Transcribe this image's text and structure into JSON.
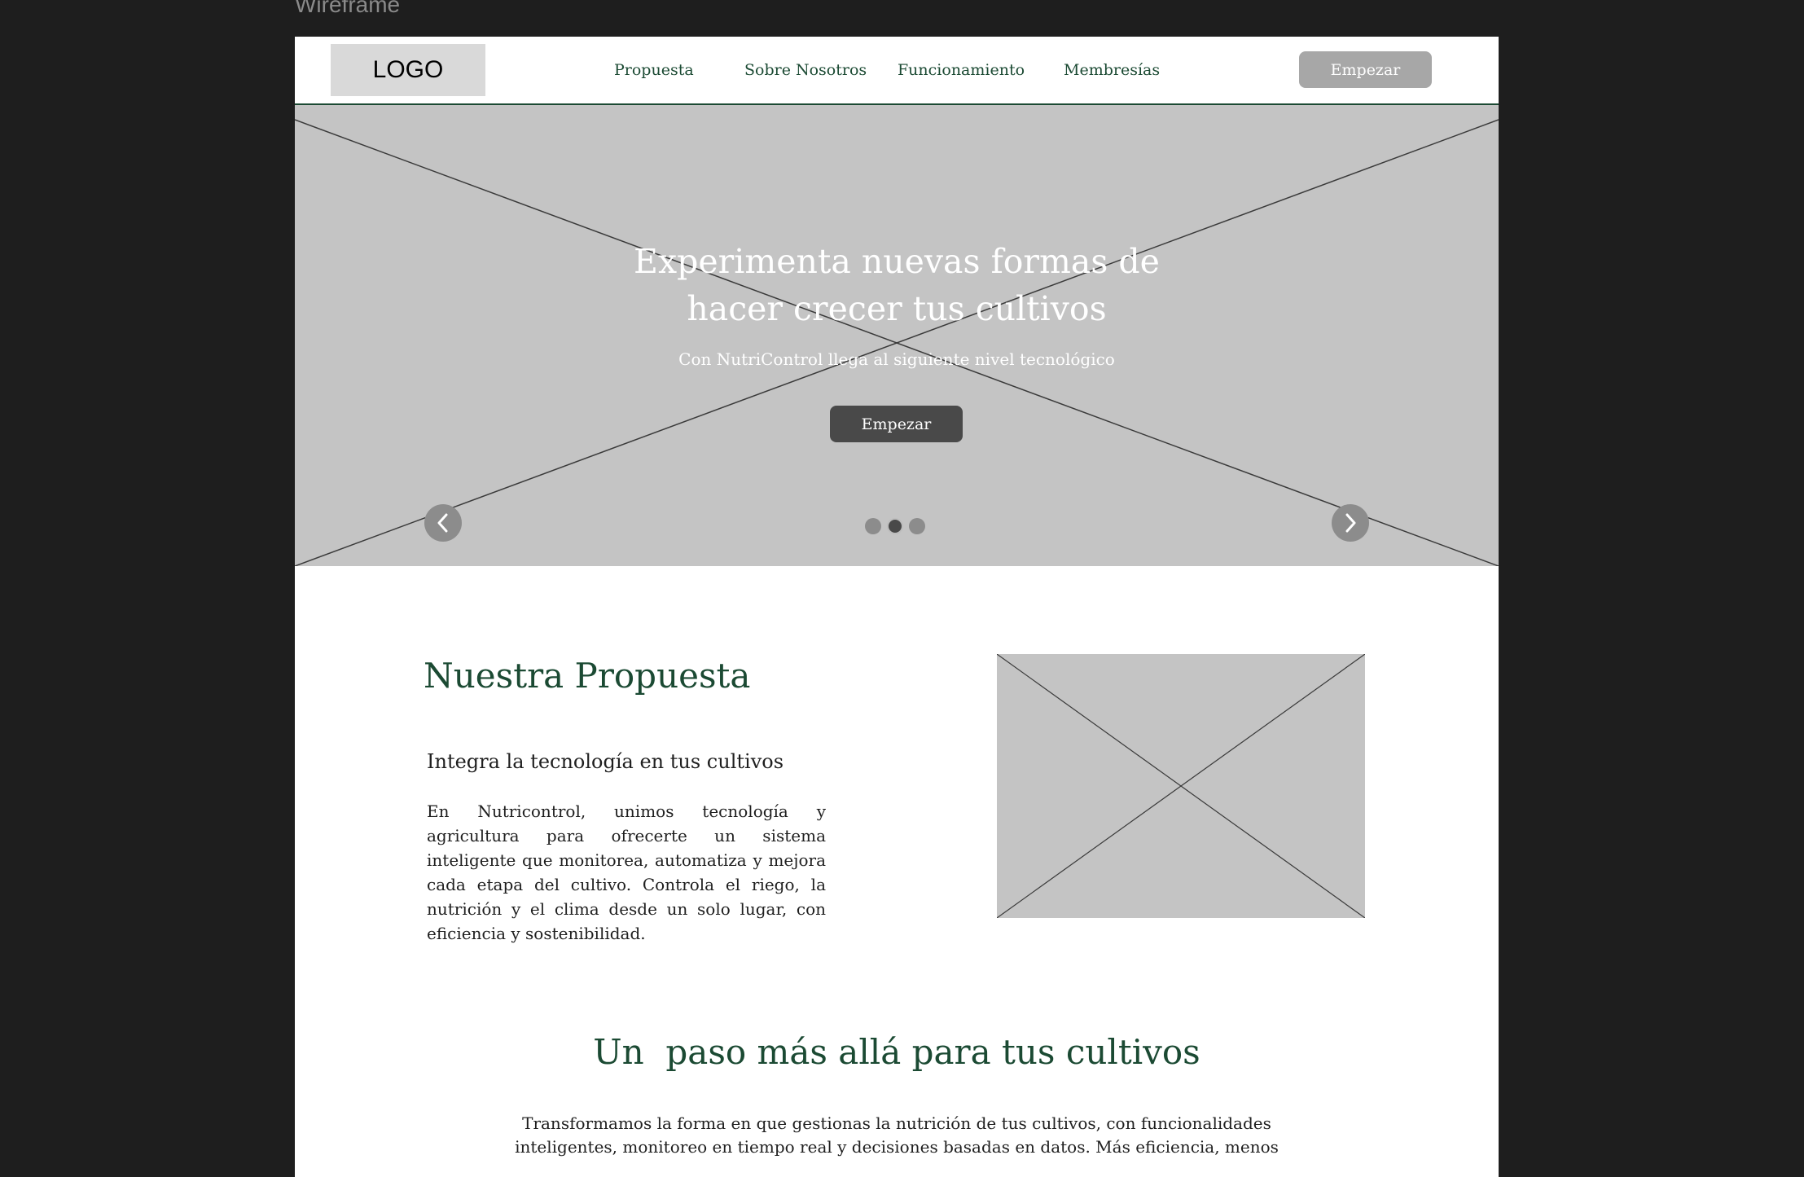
{
  "canvas": {
    "label": "Wireframe"
  },
  "header": {
    "logo": "LOGO",
    "nav": [
      "Propuesta",
      "Sobre Nosotros",
      "Funcionamiento",
      "Membresías"
    ],
    "cta": "Empezar"
  },
  "hero": {
    "title_line1": "Experimenta nuevas formas de",
    "title_line2": "hacer crecer tus cultivos",
    "subtitle": "Con NutriControl llega al siguiente nivel tecnológico",
    "cta": "Empezar",
    "carousel": {
      "slides": 3,
      "active_slide": 2
    }
  },
  "propuesta": {
    "title": "Nuestra Propuesta",
    "subtitle": "Integra la tecnología en tus cultivos",
    "body": "En Nutricontrol, unimos tecnología y agricultura para ofrecerte un sistema inteligente que monitorea, automatiza y mejora cada etapa del cultivo. Controla el riego, la nutrición y el clima desde un solo lugar, con eficiencia y sostenibilidad."
  },
  "mas_alla": {
    "title": "Un  paso más allá para tus cultivos",
    "body": "Transformamos la forma en que gestionas la nutrición de tus cultivos, con funcionalidades inteligentes, monitoreo en tiempo real y decisiones basadas en datos. Más eficiencia, menos"
  },
  "colors": {
    "brand_green": "#1b4a33",
    "placeholder_gray": "#c4c4c4",
    "dark_button": "#494949",
    "light_button": "#a7a7a7"
  },
  "icons": {
    "prev": "chevron-left-icon",
    "next": "chevron-right-icon"
  }
}
